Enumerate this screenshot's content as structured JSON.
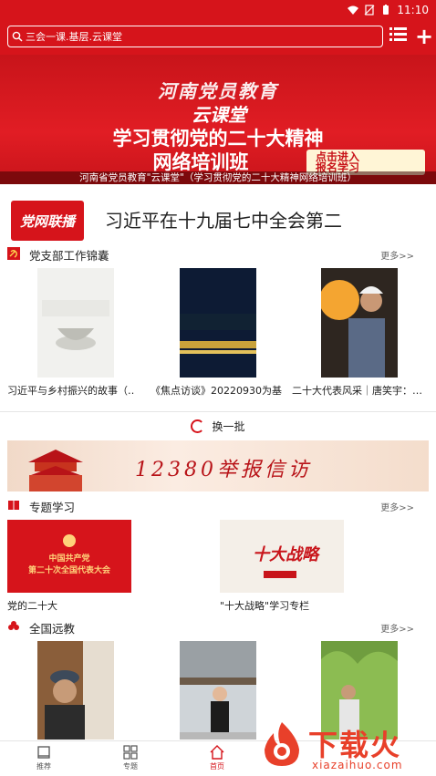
{
  "status_bar": {
    "time": "11:10"
  },
  "search": {
    "value": "三会一课.基层.云课堂"
  },
  "banner": {
    "title1": "河南党员教育",
    "title2": "云课堂",
    "headline": "学习贯彻党的二十大精神",
    "subline": "网络培训班",
    "enter_label_1": "点击进入",
    "enter_label_2": "报名学习",
    "caption": "河南省党员教育\"云课堂\"（学习贯彻党的二十大精神网络培训班）"
  },
  "headline": {
    "logo_text": "党网联播",
    "text": "习近平在十九届七中全会第二"
  },
  "party_branch": {
    "title": "党支部工作锦囊",
    "more": "更多>>",
    "items": [
      {
        "title": "习近平与乡村振兴的故事（…"
      },
      {
        "title": "《焦点访谈》20220930为基…"
      },
      {
        "title": "二十大代表风采｜唐笑宇：…"
      }
    ]
  },
  "refresh": {
    "label": "换一批"
  },
  "report_banner": {
    "text": "12380举报信访"
  },
  "special_study": {
    "title": "专题学习",
    "more": "更多>>",
    "items": [
      {
        "title": "党的二十大",
        "thumb_text_1": "中国共产党",
        "thumb_text_2": "第二十次全国代表大会"
      },
      {
        "title": "\"十大战略\"学习专栏",
        "thumb_text": "十大战略"
      }
    ]
  },
  "remote_edu": {
    "title": "全国远教",
    "more": "更多>>"
  },
  "bottom_nav": {
    "items": [
      {
        "label": "推荐"
      },
      {
        "label": "专题"
      },
      {
        "label": "首页"
      }
    ]
  },
  "watermark": {
    "text": "下载火",
    "url": "xiazaihuo.com"
  },
  "colors": {
    "brand_red": "#d6141b",
    "watermark_orange": "#e8402a"
  }
}
